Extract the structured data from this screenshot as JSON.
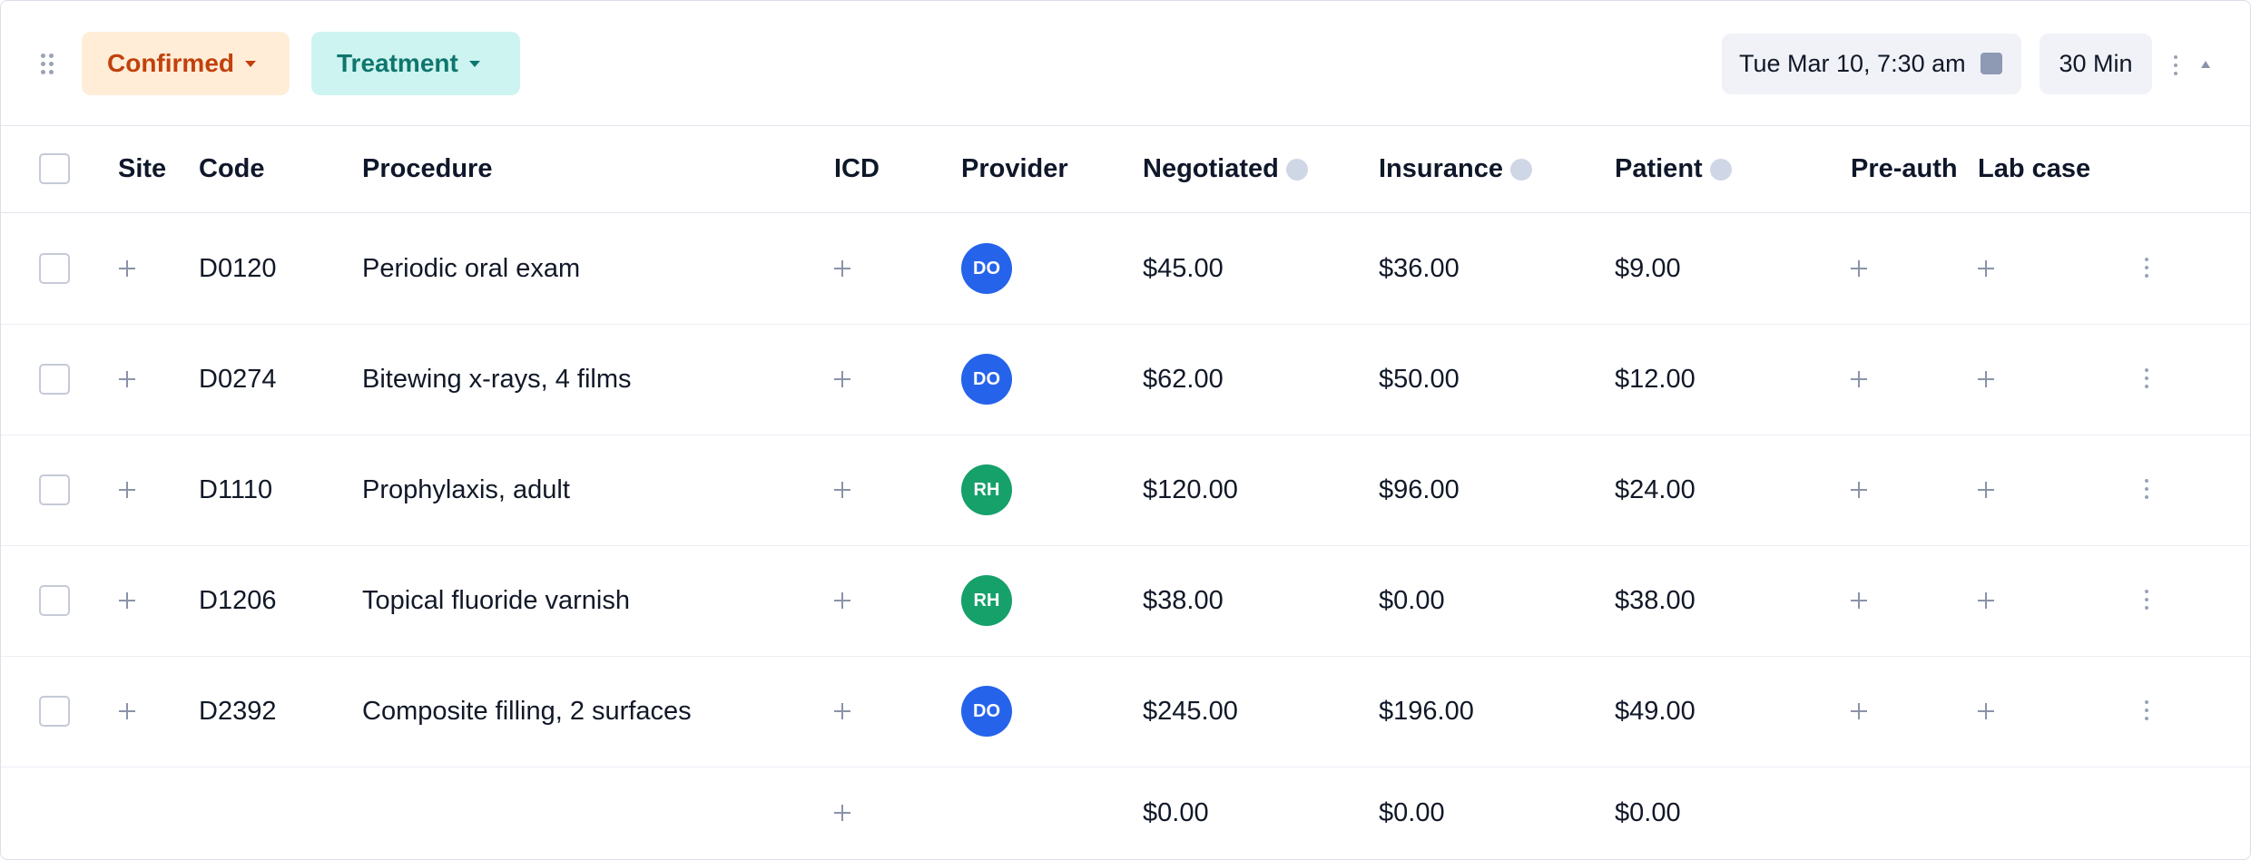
{
  "toolbar": {
    "status_label": "Confirmed",
    "type_label": "Treatment",
    "appointment_datetime": "Tue Mar 10, 7:30 am",
    "duration": "30 Min"
  },
  "colors": {
    "status_bg": "#ffedd8",
    "status_text": "#c2410c",
    "type_bg": "#cdf4f0",
    "type_text": "#0f766e",
    "provider_DO": "#2563eb",
    "provider_RH": "#16a06a"
  },
  "columns": {
    "site": "Site",
    "code": "Code",
    "procedure": "Procedure",
    "icd": "ICD",
    "provider": "Provider",
    "negotiated": "Negotiated",
    "insurance": "Insurance",
    "patient": "Patient",
    "preauth": "Pre-auth",
    "labcase": "Lab case"
  },
  "rows": [
    {
      "code": "D0120",
      "procedure": "Periodic oral exam",
      "provider": "DO",
      "negotiated": "$45.00",
      "insurance": "$36.00",
      "patient": "$9.00"
    },
    {
      "code": "D0274",
      "procedure": "Bitewing x-rays, 4 films",
      "provider": "DO",
      "negotiated": "$62.00",
      "insurance": "$50.00",
      "patient": "$12.00"
    },
    {
      "code": "D1110",
      "procedure": "Prophylaxis, adult",
      "provider": "RH",
      "negotiated": "$120.00",
      "insurance": "$96.00",
      "patient": "$24.00"
    },
    {
      "code": "D1206",
      "procedure": "Topical fluoride varnish",
      "provider": "RH",
      "negotiated": "$38.00",
      "insurance": "$0.00",
      "patient": "$38.00"
    },
    {
      "code": "D2392",
      "procedure": "Composite filling, 2 surfaces",
      "provider": "DO",
      "negotiated": "$245.00",
      "insurance": "$196.00",
      "patient": "$49.00"
    }
  ],
  "totals": {
    "negotiated": "$0.00",
    "insurance": "$0.00",
    "patient": "$0.00"
  }
}
